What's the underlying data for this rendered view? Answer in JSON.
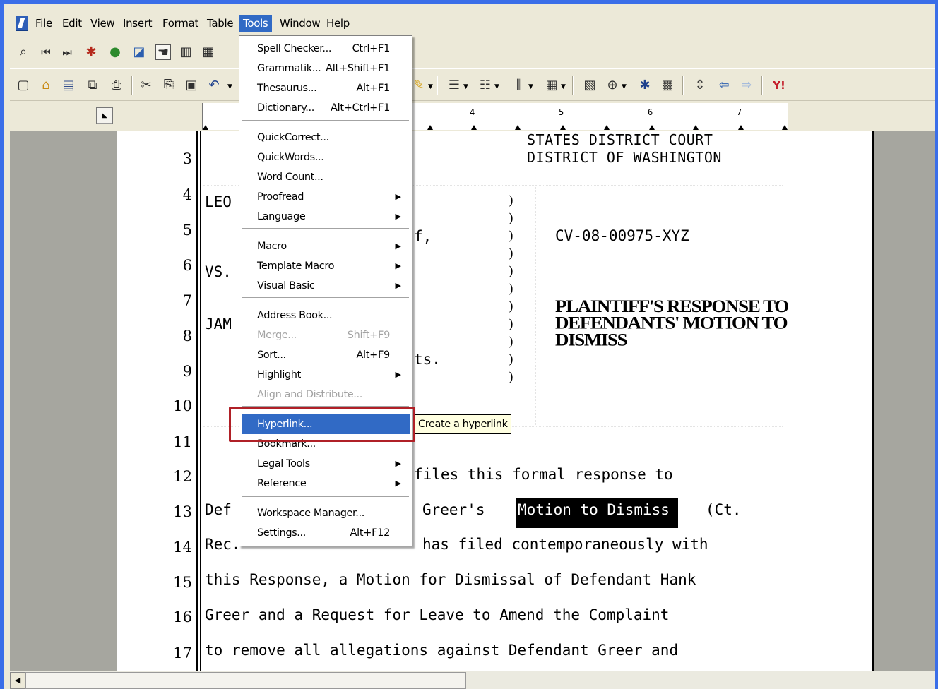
{
  "menubar": {
    "items": [
      "File",
      "Edit",
      "View",
      "Insert",
      "Format",
      "Table",
      "Tools",
      "Window",
      "Help"
    ],
    "active": "Tools"
  },
  "tools_menu": {
    "items": [
      {
        "label": "Spell Checker...",
        "shortcut": "Ctrl+F1"
      },
      {
        "label": "Grammatik...",
        "shortcut": "Alt+Shift+F1"
      },
      {
        "label": "Thesaurus...",
        "shortcut": "Alt+F1"
      },
      {
        "label": "Dictionary...",
        "shortcut": "Alt+Ctrl+F1"
      },
      {
        "label": "QuickCorrect..."
      },
      {
        "label": "QuickWords..."
      },
      {
        "label": "Word Count..."
      },
      {
        "label": "Proofread",
        "submenu": true
      },
      {
        "label": "Language",
        "submenu": true
      },
      {
        "label": "Macro",
        "submenu": true
      },
      {
        "label": "Template Macro",
        "submenu": true
      },
      {
        "label": "Visual Basic",
        "submenu": true
      },
      {
        "label": "Address Book..."
      },
      {
        "label": "Merge...",
        "shortcut": "Shift+F9",
        "disabled": true
      },
      {
        "label": "Sort...",
        "shortcut": "Alt+F9"
      },
      {
        "label": "Highlight",
        "submenu": true
      },
      {
        "label": "Align and Distribute...",
        "disabled": true
      },
      {
        "label": "Hyperlink...",
        "selected": true
      },
      {
        "label": "Bookmark..."
      },
      {
        "label": "Legal Tools",
        "submenu": true
      },
      {
        "label": "Reference",
        "submenu": true
      },
      {
        "label": "Workspace Manager..."
      },
      {
        "label": "Settings...",
        "shortcut": "Alt+F12"
      }
    ],
    "tooltip": "Create a hyperlink"
  },
  "ruler": {
    "numbers": [
      "4",
      "5",
      "6",
      "7"
    ]
  },
  "document": {
    "court_line_1": "STATES DISTRICT COURT",
    "court_line_2": "DISTRICT OF WASHINGTON",
    "line_numbers": [
      "3",
      "4",
      "5",
      "6",
      "7",
      "8",
      "9",
      "10",
      "11",
      "12",
      "13",
      "14",
      "15",
      "16",
      "17"
    ],
    "party_plaintiff_fragment": "LEO",
    "plaintiff_suffix": "f,",
    "vs": "VS.",
    "party_defendant_fragment": "JAM",
    "defendant_suffix": "ts.",
    "case_number": "CV-08-00975-XYZ",
    "caption_title": "PLAINTIFF'S RESPONSE TO DEFENDANTS' MOTION TO DISMISS",
    "body_line_12": "files this formal response to",
    "body_line_13_start": "Def",
    "body_line_13_mid": "Greer's",
    "body_line_13_highlight": "Motion to Dismiss",
    "body_line_13_end": "(Ct.",
    "body_line_14_start": "Rec.",
    "body_line_14_end": "has filed contemporaneously with",
    "body_line_15": "this Response, a Motion for Dismissal of Defendant Hank",
    "body_line_16": "Greer and a Request for  Leave to Amend the Complaint",
    "body_line_17": "to remove all allegations against Defendant Greer and"
  },
  "icons": {
    "toolbar1": [
      "zoom-icon",
      "first-page-icon",
      "last-page-icon",
      "bug-icon",
      "globe-icon",
      "color-icon",
      "hand-icon",
      "book-icon",
      "grid-icon"
    ],
    "toolbar2": [
      "new-icon",
      "open-icon",
      "save-icon",
      "copy-icon",
      "print-icon",
      "cut-icon",
      "paste-icon",
      "clipboard-icon",
      "undo-icon"
    ]
  },
  "colors": {
    "menu_highlight": "#316ac5",
    "redbox": "#b02027",
    "tooltip_bg": "#ffffe1"
  }
}
